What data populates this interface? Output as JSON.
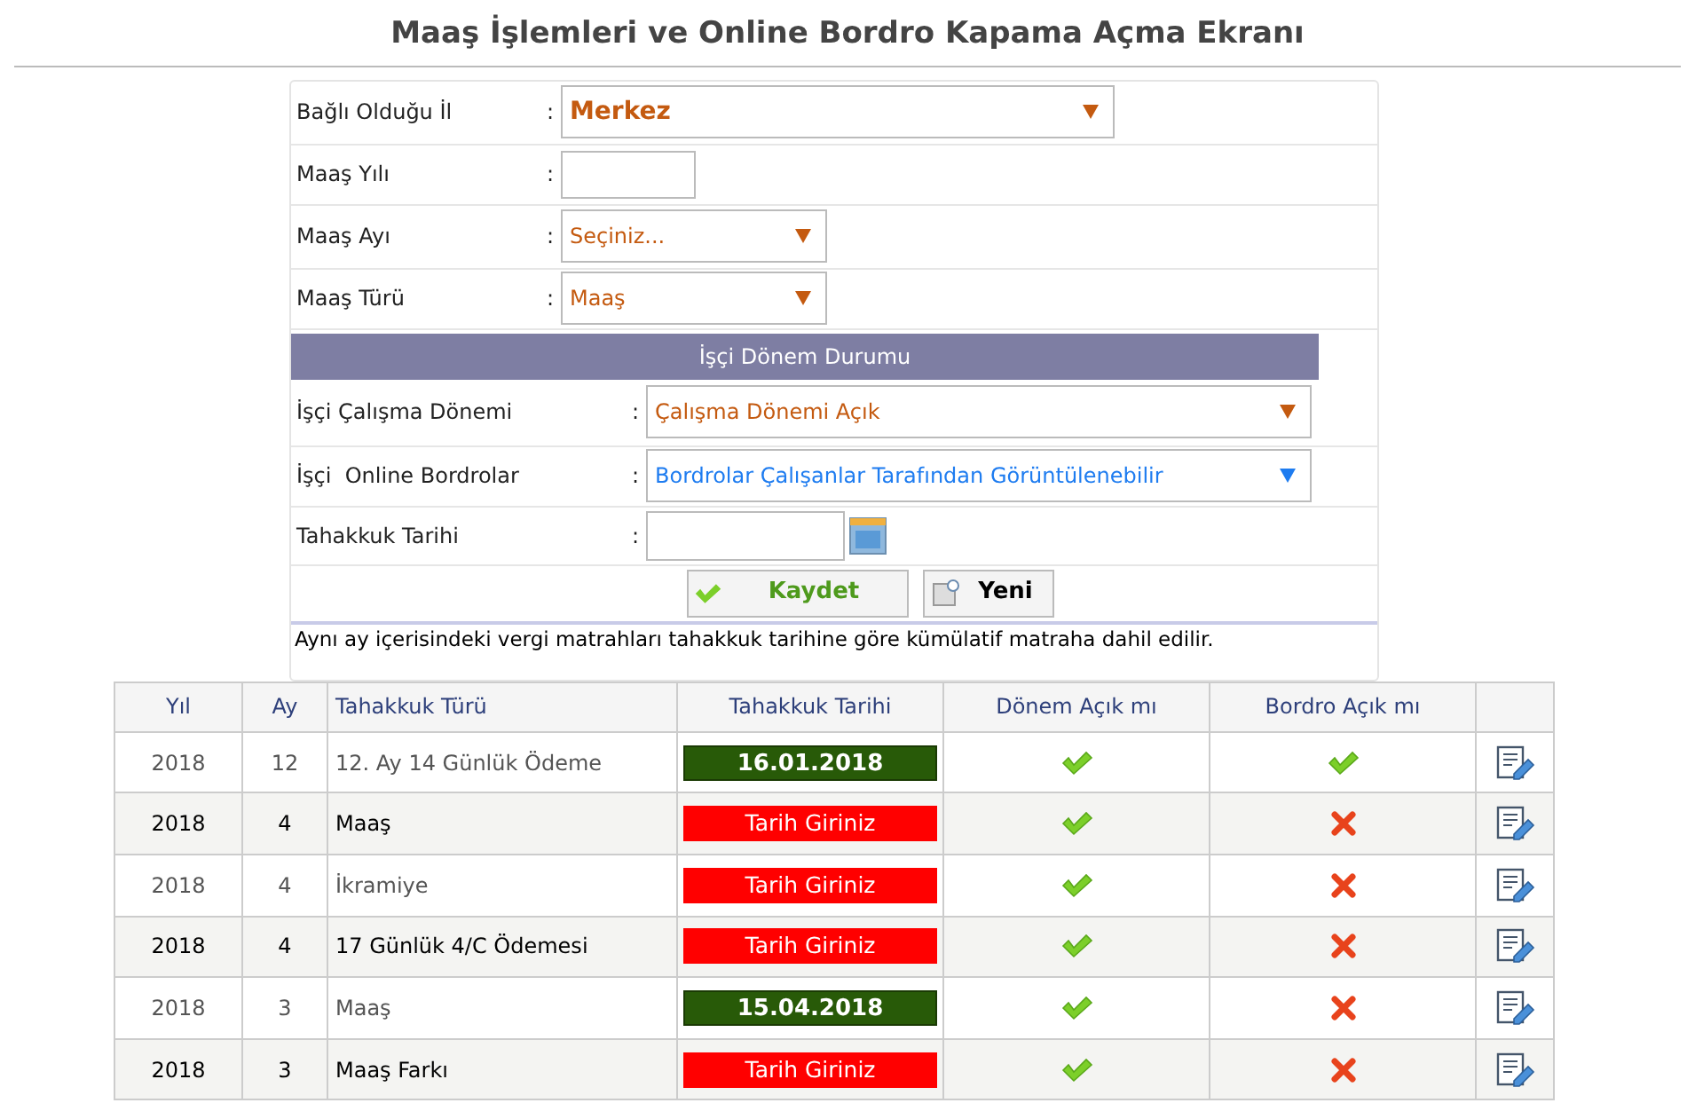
{
  "title": "Maaş İşlemleri ve Online Bordro Kapama Açma Ekranı",
  "form": {
    "fields": [
      {
        "kind": "wide_select",
        "label": "Bağlı Olduğu İl",
        "separator": ":",
        "value": "Merkez",
        "color": "#c45a10"
      },
      {
        "kind": "input",
        "label": "Maaş Yılı",
        "separator": ":"
      },
      {
        "kind": "select",
        "label": "Maaş Ayı",
        "separator": ":",
        "value": "Seçiniz...",
        "color": "#c45a10"
      },
      {
        "kind": "select",
        "label": "Maaş Türü",
        "separator": ":",
        "value": "Maaş",
        "color": "#c45a10"
      }
    ],
    "section_title": "İşçi Dönem Durumu",
    "section_fields": [
      {
        "kind": "long_select",
        "label": "İşçi Çalışma Dönemi",
        "separator": ":",
        "value": "Çalışma Dönemi Açık",
        "color": "#c45a10"
      },
      {
        "kind": "long_select",
        "label": "İşçi  Online Bordrolar",
        "separator": ":",
        "value": "Bordrolar Çalışanlar Tarafından Görüntülenebilir",
        "color": "#1e7cf0"
      },
      {
        "kind": "date",
        "label": "Tahakkuk Tarihi",
        "separator": ":"
      }
    ],
    "buttons": [
      {
        "kind": "save",
        "label": "Kaydet"
      },
      {
        "kind": "new",
        "label": "Yeni"
      }
    ],
    "note": "Aynı ay içerisindeki vergi matrahları tahakkuk tarihine göre kümülatif matraha dahil edilir."
  },
  "table": {
    "columns": [
      "Yıl",
      "Ay",
      "Tahakkuk Türü",
      "Tahakkuk Tarihi",
      "Dönem Açık mı",
      "Bordro Açık mı"
    ],
    "rows": [
      {
        "year": "2018",
        "month": "12",
        "type": "12. Ay 14 Günlük Ödeme",
        "kind": "date",
        "date": "16.01.2018",
        "donem_open": true,
        "bordro_open": true
      },
      {
        "year": "2018",
        "month": "4",
        "type": "Maaş",
        "kind": "prompt",
        "date": "Tarih Giriniz",
        "donem_open": true,
        "bordro_open": false
      },
      {
        "year": "2018",
        "month": "4",
        "type": "İkramiye",
        "kind": "prompt",
        "date": "Tarih Giriniz",
        "donem_open": true,
        "bordro_open": false
      },
      {
        "year": "2018",
        "month": "4",
        "type": "17 Günlük 4/C Ödemesi",
        "kind": "prompt",
        "date": "Tarih Giriniz",
        "donem_open": true,
        "bordro_open": false
      },
      {
        "year": "2018",
        "month": "3",
        "type": "Maaş",
        "kind": "date",
        "date": "15.04.2018",
        "donem_open": true,
        "bordro_open": false
      },
      {
        "year": "2018",
        "month": "3",
        "type": "Maaş Farkı",
        "kind": "prompt",
        "date": "Tarih Giriniz",
        "donem_open": true,
        "bordro_open": false
      }
    ]
  }
}
